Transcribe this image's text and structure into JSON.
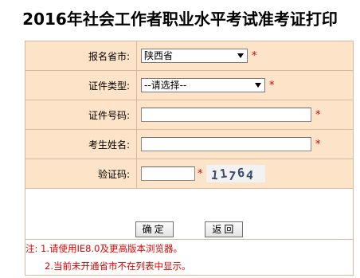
{
  "page_title": "2016年社会工作者职业水平考试准考证打印",
  "form": {
    "province": {
      "label": "报名省市:",
      "value": "陕西省"
    },
    "id_type": {
      "label": "证件类型:",
      "value": "--请选择--"
    },
    "id_number": {
      "label": "证件号码:",
      "value": ""
    },
    "name": {
      "label": "考生姓名:",
      "value": ""
    },
    "captcha": {
      "label": "验证码:",
      "value": "",
      "image_text": "11764"
    },
    "required_mark": "*"
  },
  "buttons": {
    "confirm": "确定",
    "back": "返回"
  },
  "notes": [
    "注: 1.请使用IE8.0及更高版本浏览器。",
    "2.当前未开通省市不在列表中显示。"
  ],
  "colors": {
    "row_bg": "#fde3c8",
    "border": "#d9b99a",
    "required": "#e00000"
  }
}
